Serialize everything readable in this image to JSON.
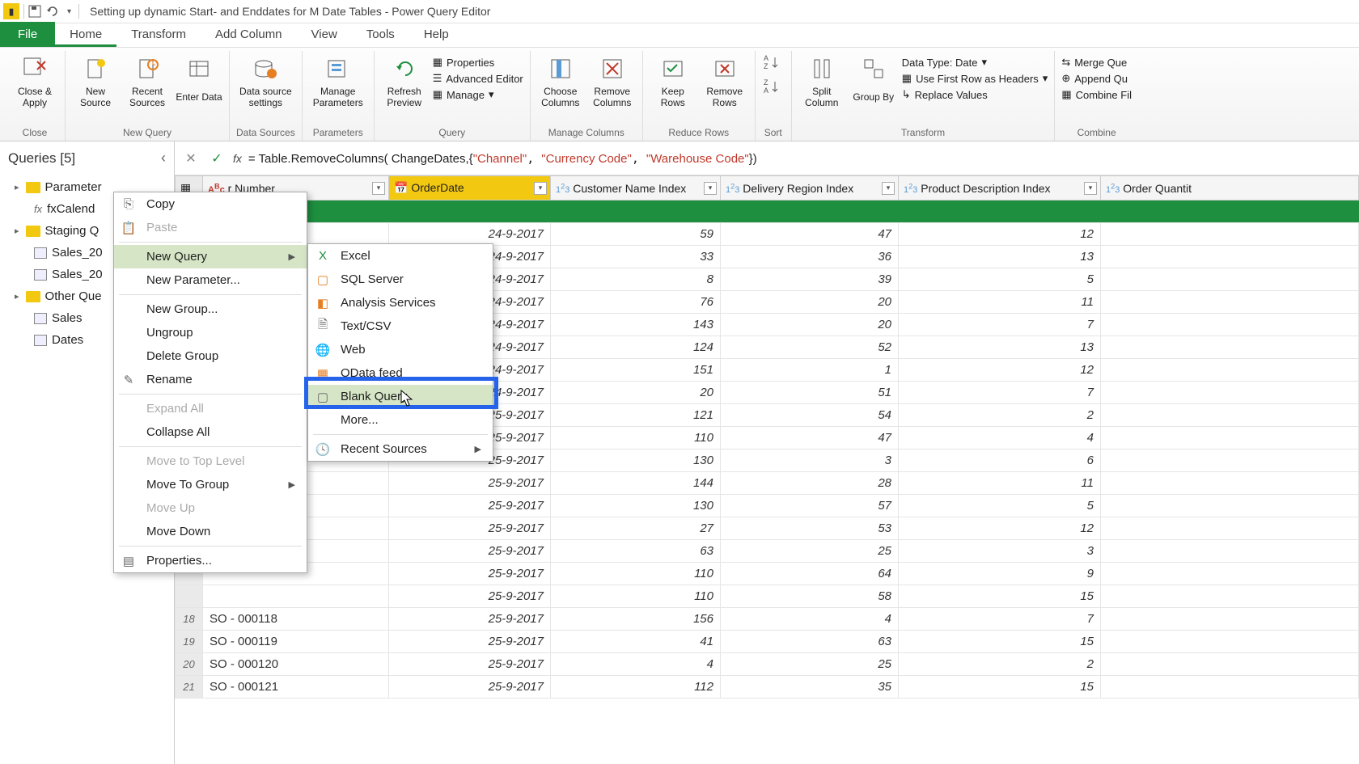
{
  "titlebar": {
    "title": "Setting up dynamic Start- and Enddates for M Date Tables - Power Query Editor"
  },
  "tabs": {
    "file": "File",
    "home": "Home",
    "transform": "Transform",
    "addcolumn": "Add Column",
    "view": "View",
    "tools": "Tools",
    "help": "Help"
  },
  "ribbon": {
    "close": {
      "close_apply": "Close & Apply",
      "group": "Close"
    },
    "newquery": {
      "new_source": "New Source",
      "recent_sources": "Recent Sources",
      "enter_data": "Enter Data",
      "group": "New Query"
    },
    "datasources": {
      "settings": "Data source settings",
      "group": "Data Sources"
    },
    "parameters": {
      "manage": "Manage Parameters",
      "group": "Parameters"
    },
    "query": {
      "refresh": "Refresh Preview",
      "properties": "Properties",
      "advanced": "Advanced Editor",
      "manage": "Manage",
      "group": "Query"
    },
    "managecols": {
      "choose": "Choose Columns",
      "remove": "Remove Columns",
      "group": "Manage Columns"
    },
    "reducerows": {
      "keep": "Keep Rows",
      "remove": "Remove Rows",
      "group": "Reduce Rows"
    },
    "sort": {
      "group": "Sort"
    },
    "transform": {
      "split": "Split Column",
      "groupby": "Group By",
      "datatype": "Data Type: Date",
      "firstrow": "Use First Row as Headers",
      "replace": "Replace Values",
      "group": "Transform"
    },
    "combine": {
      "merge": "Merge Que",
      "append": "Append Qu",
      "combine_files": "Combine Fil",
      "group": "Combine"
    }
  },
  "queries_panel": {
    "header": "Queries [5]",
    "items": {
      "parameters": "Parameter",
      "fxcalendar": "fxCalend",
      "staging": "Staging Q",
      "sales201": "Sales_20",
      "sales202": "Sales_20",
      "other": "Other Que",
      "sales": "Sales",
      "dates": "Dates"
    }
  },
  "formula": {
    "prefix": "= Table.RemoveColumns( ChangeDates,{",
    "s1": "\"Channel\"",
    "s2": "\"Currency Code\"",
    "s3": "\"Warehouse Code\"",
    "suffix": "})"
  },
  "context1": {
    "copy": "Copy",
    "paste": "Paste",
    "new_query": "New Query",
    "new_parameter": "New Parameter...",
    "new_group": "New Group...",
    "ungroup": "Ungroup",
    "delete_group": "Delete Group",
    "rename": "Rename",
    "expand_all": "Expand All",
    "collapse_all": "Collapse All",
    "move_top": "Move to Top Level",
    "move_group": "Move To Group",
    "move_up": "Move Up",
    "move_down": "Move Down",
    "properties": "Properties..."
  },
  "context2": {
    "excel": "Excel",
    "sql": "SQL Server",
    "analysis": "Analysis Services",
    "textcsv": "Text/CSV",
    "web": "Web",
    "odata": "OData feed",
    "blank": "Blank Query",
    "more": "More...",
    "recent": "Recent Sources"
  },
  "columns": {
    "order_number_partial": "r Number",
    "order_date": "OrderDate",
    "customer_idx": "Customer Name Index",
    "delivery_idx": "Delivery Region Index",
    "product_idx": "Product Description Index",
    "order_qty": "Order Quantit"
  },
  "rows": [
    {
      "n": "",
      "on": "",
      "od": "24-9-2017",
      "c": "59",
      "d": "47",
      "p": "12"
    },
    {
      "n": "",
      "on": "",
      "od": "24-9-2017",
      "c": "33",
      "d": "36",
      "p": "13"
    },
    {
      "n": "",
      "on": "",
      "od": "24-9-2017",
      "c": "8",
      "d": "39",
      "p": "5"
    },
    {
      "n": "",
      "on": "",
      "od": "24-9-2017",
      "c": "76",
      "d": "20",
      "p": "11"
    },
    {
      "n": "",
      "on": "",
      "od": "24-9-2017",
      "c": "143",
      "d": "20",
      "p": "7"
    },
    {
      "n": "",
      "on": "",
      "od": "24-9-2017",
      "c": "124",
      "d": "52",
      "p": "13"
    },
    {
      "n": "",
      "on": "",
      "od": "24-9-2017",
      "c": "151",
      "d": "1",
      "p": "12"
    },
    {
      "n": "",
      "on": "",
      "od": "24-9-2017",
      "c": "20",
      "d": "51",
      "p": "7"
    },
    {
      "n": "",
      "on": "",
      "od": "25-9-2017",
      "c": "121",
      "d": "54",
      "p": "2"
    },
    {
      "n": "",
      "on": "",
      "od": "25-9-2017",
      "c": "110",
      "d": "47",
      "p": "4"
    },
    {
      "n": "",
      "on": "",
      "od": "25-9-2017",
      "c": "130",
      "d": "3",
      "p": "6"
    },
    {
      "n": "",
      "on": "",
      "od": "25-9-2017",
      "c": "144",
      "d": "28",
      "p": "11"
    },
    {
      "n": "",
      "on": "",
      "od": "25-9-2017",
      "c": "130",
      "d": "57",
      "p": "5"
    },
    {
      "n": "",
      "on": "",
      "od": "25-9-2017",
      "c": "27",
      "d": "53",
      "p": "12"
    },
    {
      "n": "",
      "on": "",
      "od": "25-9-2017",
      "c": "63",
      "d": "25",
      "p": "3"
    },
    {
      "n": "",
      "on": "",
      "od": "25-9-2017",
      "c": "110",
      "d": "64",
      "p": "9"
    },
    {
      "n": "",
      "on": "",
      "od": "25-9-2017",
      "c": "110",
      "d": "58",
      "p": "15"
    },
    {
      "n": "18",
      "on": "SO - 000118",
      "od": "25-9-2017",
      "c": "156",
      "d": "4",
      "p": "7"
    },
    {
      "n": "19",
      "on": "SO - 000119",
      "od": "25-9-2017",
      "c": "41",
      "d": "63",
      "p": "15"
    },
    {
      "n": "20",
      "on": "SO - 000120",
      "od": "25-9-2017",
      "c": "4",
      "d": "25",
      "p": "2"
    },
    {
      "n": "21",
      "on": "SO - 000121",
      "od": "25-9-2017",
      "c": "112",
      "d": "35",
      "p": "15"
    }
  ]
}
